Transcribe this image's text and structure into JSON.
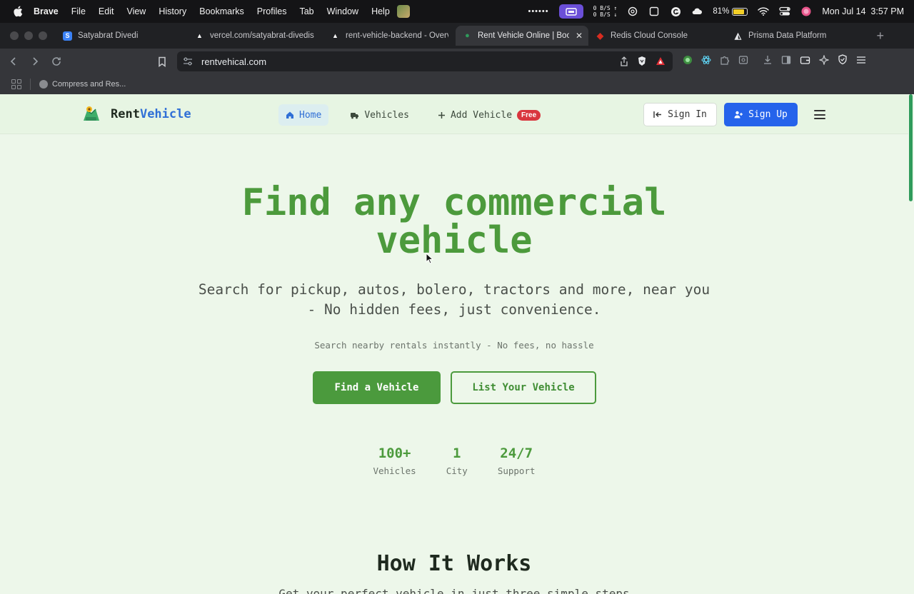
{
  "menubar": {
    "app": "Brave",
    "items": [
      "File",
      "Edit",
      "View",
      "History",
      "Bookmarks",
      "Profiles",
      "Tab",
      "Window",
      "Help"
    ],
    "net_up": "0 B/S",
    "net_down": "0 B/S",
    "battery": "81%",
    "clock": "Mon Jul 14  3:57 PM"
  },
  "tabs": [
    {
      "title": "Satyabrat Divedi",
      "favicon_color": "#3b82f6",
      "favicon_glyph": "S"
    },
    {
      "title": "vercel.com/satyabrat-divedis",
      "favicon_color": "#000000",
      "favicon_glyph": "▲"
    },
    {
      "title": "rent-vehicle-backend - Overv",
      "favicon_color": "#000000",
      "favicon_glyph": "▲"
    },
    {
      "title": "Rent Vehicle Online | Book",
      "favicon_color": "#2f9b5b",
      "favicon_glyph": "●",
      "active": true
    },
    {
      "title": "Redis Cloud Console",
      "favicon_color": "#d82c20",
      "favicon_glyph": "◆"
    },
    {
      "title": "Prisma Data Platform",
      "favicon_color": "#1a202c",
      "favicon_glyph": "◭"
    }
  ],
  "address": {
    "url": "rentvehical.com"
  },
  "bookmarks": [
    {
      "label": "Compress and Res..."
    }
  ],
  "site": {
    "brand_a": "Rent",
    "brand_b": "Vehicle",
    "nav": {
      "home": "Home",
      "vehicles": "Vehicles",
      "add_vehicle": "Add Vehicle",
      "free_badge": "Free"
    },
    "sign_in": "Sign In",
    "sign_up": "Sign Up"
  },
  "hero": {
    "title_line1": "Find any commercial",
    "title_line2": "vehicle",
    "subtitle_line1": "Search for pickup, autos, bolero, tractors and more, near you",
    "subtitle_line2": "- No hidden fees, just convenience.",
    "small": "Search nearby rentals instantly - No fees, no hassle",
    "cta_primary": "Find a Vehicle",
    "cta_secondary": "List Your Vehicle"
  },
  "stats": [
    {
      "value": "100+",
      "label": "Vehicles"
    },
    {
      "value": "1",
      "label": "City"
    },
    {
      "value": "24/7",
      "label": "Support"
    }
  ],
  "how": {
    "title": "How It Works",
    "subtitle": "Get your perfect vehicle in just three simple steps"
  },
  "colors": {
    "accent_green": "#4c9a3c",
    "accent_blue": "#2563eb",
    "page_bg": "#edf7ea"
  }
}
